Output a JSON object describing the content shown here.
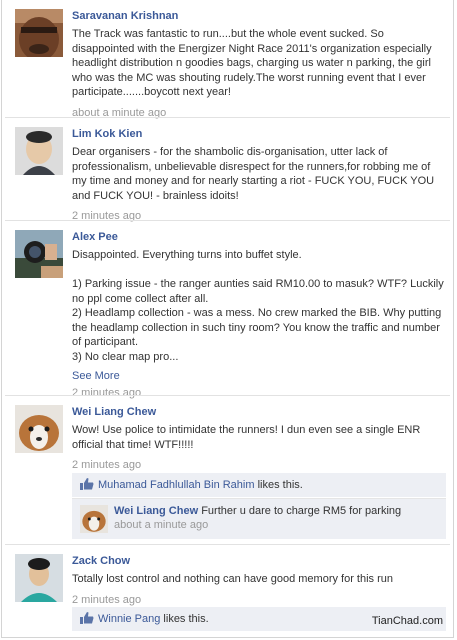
{
  "posts": [
    {
      "name": "Saravanan Krishnan",
      "text": "The Track was fantastic to run....but the whole event sucked. So disappointed with the Energizer Night Race 2011's organization especially headlight distribution n goodies bags, charging us water n parking, the girl who was the MC was shouting rudely.The worst running event that I ever participate.......boycott next year!",
      "time": "about a minute ago"
    },
    {
      "name": "Lim Kok Kien",
      "text": "Dear organisers - for the shambolic dis-organisation, utter lack of professionalism, unbelievable disrespect for the runners,for robbing me of my time and money and for nearly starting a riot - FUCK YOU, FUCK YOU and FUCK YOU! - brainless idoits!",
      "time": "2 minutes ago"
    },
    {
      "name": "Alex Pee",
      "text_lines": [
        "Disappointed. Everything turns into buffet style.",
        "",
        "1) Parking issue - the ranger aunties said RM10.00 to masuk? WTF? Luckily no ppl come collect after all.",
        "2) Headlamp collection - was a mess. No crew marked the BIB. Why putting the headlamp collection in such tiny room? You know the traffic and number of participant.",
        "3) No clear map pro..."
      ],
      "see_more": "See More",
      "time": "2 minutes ago"
    },
    {
      "name": "Wei Liang Chew",
      "text": "Wow! Use police to intimidate the runners! I dun even see a single ENR official that time! WTF!!!!!",
      "time": "2 minutes ago",
      "likes": {
        "liker": "Muhamad Fadhlullah Bin Rahim",
        "suffix": " likes this."
      },
      "reply": {
        "name": "Wei Liang Chew",
        "text": "Further u dare to charge RM5 for parking",
        "time": "about a minute ago"
      }
    },
    {
      "name": "Zack Chow",
      "text": "Totally lost control and nothing can have good memory for this run",
      "time": "2 minutes ago",
      "likes": {
        "liker": "Winnie Pang",
        "suffix": " likes this."
      }
    }
  ],
  "watermark": "TianChad.com",
  "colors": {
    "link": "#3b5998",
    "meta": "#999999",
    "likes_bg": "#edeff4"
  },
  "icons": {
    "like": "thumbs-up-icon"
  }
}
